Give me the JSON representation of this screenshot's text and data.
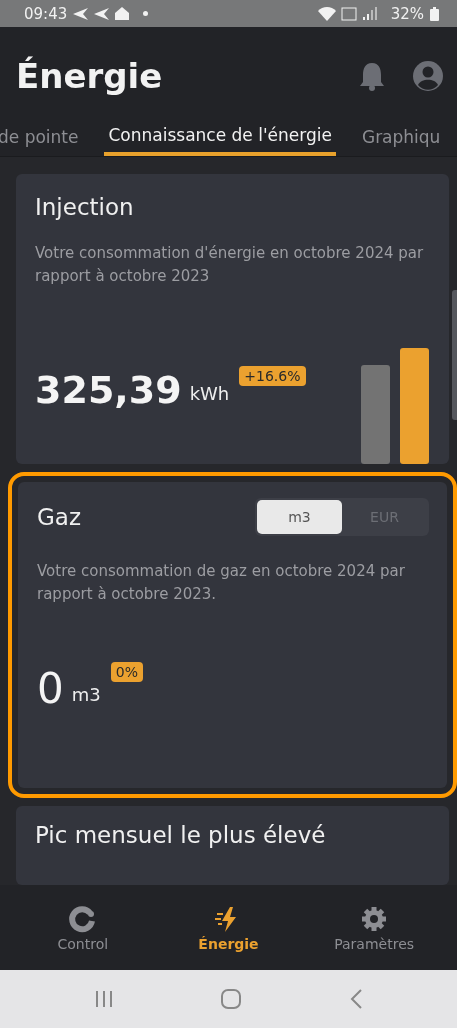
{
  "status_bar": {
    "time": "09:43",
    "battery": "32%"
  },
  "header": {
    "title": "Énergie"
  },
  "tabs": [
    {
      "label": "de pointe",
      "selected": false
    },
    {
      "label": "Connaissance de l'énergie",
      "selected": true
    },
    {
      "label": "Graphiqu",
      "selected": false
    }
  ],
  "cards": [
    {
      "kind": "bars",
      "title": "Injection",
      "description": "Votre consommation d'énergie en octobre 2024 par rapport à octobre 2023",
      "value": "325,39",
      "unit": "kWh",
      "change": "+16.6%",
      "highlighted": false
    },
    {
      "kind": "toggle",
      "title": "Gaz",
      "units": [
        {
          "label": "m3",
          "selected": true
        },
        {
          "label": "EUR",
          "selected": false
        }
      ],
      "description": "Votre consommation de gaz en octobre 2024 par rapport à octobre 2023.",
      "value": "0",
      "unit": "m3",
      "change": "0%",
      "highlighted": true
    },
    {
      "kind": "title",
      "title": "Pic mensuel le plus élevé",
      "highlighted": false
    }
  ],
  "bottom_nav": [
    {
      "kind": "control",
      "label": "Control",
      "selected": false
    },
    {
      "kind": "energy",
      "label": "Énergie",
      "selected": true
    },
    {
      "kind": "settings",
      "label": "Paramètres",
      "selected": false
    }
  ]
}
